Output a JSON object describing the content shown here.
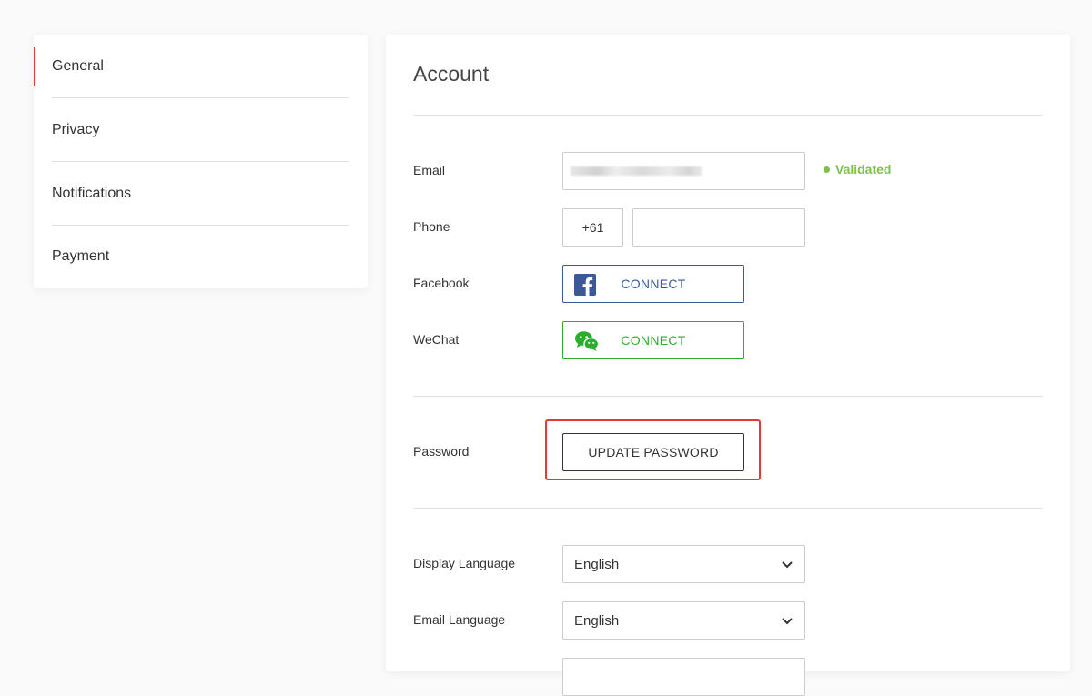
{
  "sidebar": {
    "items": [
      {
        "label": "General",
        "active": true
      },
      {
        "label": "Privacy"
      },
      {
        "label": "Notifications"
      },
      {
        "label": "Payment"
      }
    ]
  },
  "account": {
    "title": "Account",
    "email": {
      "label": "Email",
      "status": "Validated"
    },
    "phone": {
      "label": "Phone",
      "country_code": "+61",
      "value": ""
    },
    "facebook": {
      "label": "Facebook",
      "button": "CONNECT",
      "icon": "facebook-icon",
      "color": "#3b5998"
    },
    "wechat": {
      "label": "WeChat",
      "button": "CONNECT",
      "icon": "wechat-icon",
      "color": "#2aae2b"
    },
    "password": {
      "label": "Password",
      "button": "UPDATE PASSWORD"
    },
    "display_language": {
      "label": "Display Language",
      "value": "English"
    },
    "email_language": {
      "label": "Email Language",
      "value": "English"
    }
  },
  "colors": {
    "accent": "#e53935",
    "validated": "#7cc24a"
  }
}
